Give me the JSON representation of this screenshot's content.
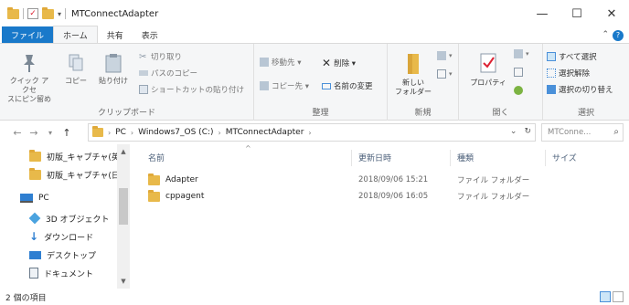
{
  "window": {
    "title": "MTConnectAdapter",
    "controls": {
      "minimize": "—",
      "maximize": "☐",
      "close": "✕"
    }
  },
  "qat": {
    "dropdown": "▾"
  },
  "ribbon_tabs": [
    {
      "label": "ファイル"
    },
    {
      "label": "ホーム"
    },
    {
      "label": "共有"
    },
    {
      "label": "表示"
    }
  ],
  "ribbon": {
    "clipboard": {
      "label": "クリップボード",
      "pin": "クイック アクセ\nスにピン留め",
      "copy": "コピー",
      "paste": "貼り付け",
      "cut": "切り取り",
      "copy_path": "パスのコピー",
      "paste_shortcut": "ショートカットの貼り付け"
    },
    "organize": {
      "label": "整理",
      "move_to": "移動先 ▾",
      "copy_to": "コピー先 ▾",
      "delete": "削除 ▾",
      "rename": "名前の変更"
    },
    "new": {
      "label": "新規",
      "new_folder": "新しい\nフォルダー"
    },
    "open": {
      "label": "開く",
      "properties": "プロパティ"
    },
    "select": {
      "label": "選択",
      "select_all": "すべて選択",
      "select_none": "選択解除",
      "invert": "選択の切り替え"
    }
  },
  "address": {
    "crumbs": [
      "PC",
      "Windows7_OS (C:)",
      "MTConnectAdapter"
    ],
    "search_placeholder": "MTConne..."
  },
  "nav_pane": {
    "items": [
      {
        "label": "初版_キャプチャ(英",
        "icon": "folder-icon"
      },
      {
        "label": "初版_キャプチャ(日",
        "icon": "folder-icon"
      },
      {
        "label": "PC",
        "icon": "pc-icon"
      },
      {
        "label": "3D オブジェクト",
        "icon": "3d-objects-icon"
      },
      {
        "label": "ダウンロード",
        "icon": "download-icon"
      },
      {
        "label": "デスクトップ",
        "icon": "desktop-icon"
      },
      {
        "label": "ドキュメント",
        "icon": "documents-icon"
      }
    ]
  },
  "file_list": {
    "columns": [
      "名前",
      "更新日時",
      "種類",
      "サイズ"
    ],
    "rows": [
      {
        "name": "Adapter",
        "date": "2018/09/06 15:21",
        "type": "ファイル フォルダー"
      },
      {
        "name": "cppagent",
        "date": "2018/09/06 16:05",
        "type": "ファイル フォルダー"
      }
    ]
  },
  "status": {
    "item_count": "2 個の項目"
  },
  "colors": {
    "accent": "#1979ca",
    "folder": "#e8b94a",
    "ribbon_bg": "#f5f6f7"
  }
}
